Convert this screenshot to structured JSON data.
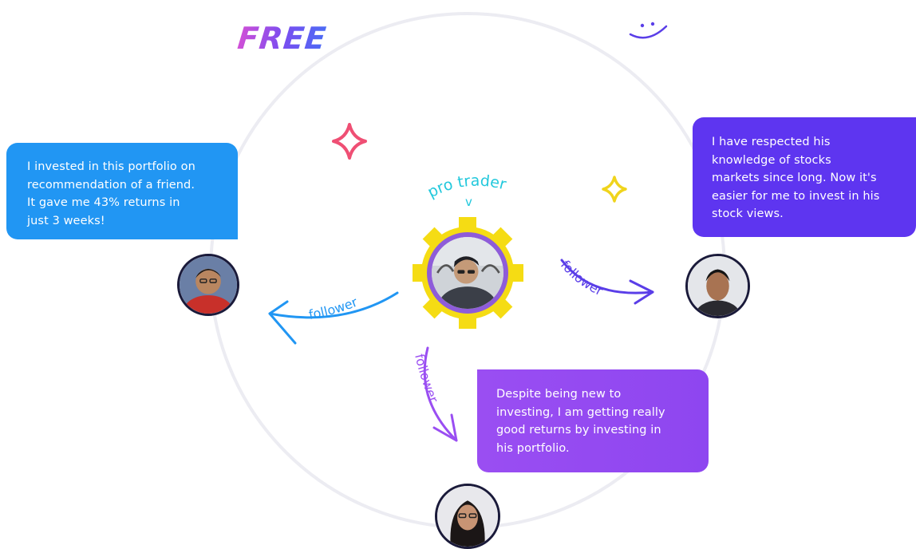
{
  "badge": {
    "free": "FREE"
  },
  "center": {
    "label": "pro trader",
    "caret": "v"
  },
  "followers": {
    "left": "follower",
    "right": "follower",
    "bottom": "follower"
  },
  "testimonials": {
    "left": [
      "I invested in this portfolio on",
      "recommendation of a friend.",
      "It gave me 43% returns in",
      "just 3 weeks!"
    ],
    "right": [
      "I have respected his",
      "knowledge of stocks",
      "markets since long. Now it's",
      "easier for me to invest in his",
      "stock views."
    ],
    "bottom": [
      "Despite being new to",
      "investing, I am getting really",
      "good returns by investing in",
      "his portfolio."
    ]
  },
  "colors": {
    "blue": "#2196f3",
    "indigo": "#5e35f0",
    "purple": "#9a4ef2",
    "cyan": "#22c8dc",
    "gear": "#f5dc14",
    "pink_sparkle": "#ef4f74",
    "yellow_sparkle": "#f0d41c"
  }
}
